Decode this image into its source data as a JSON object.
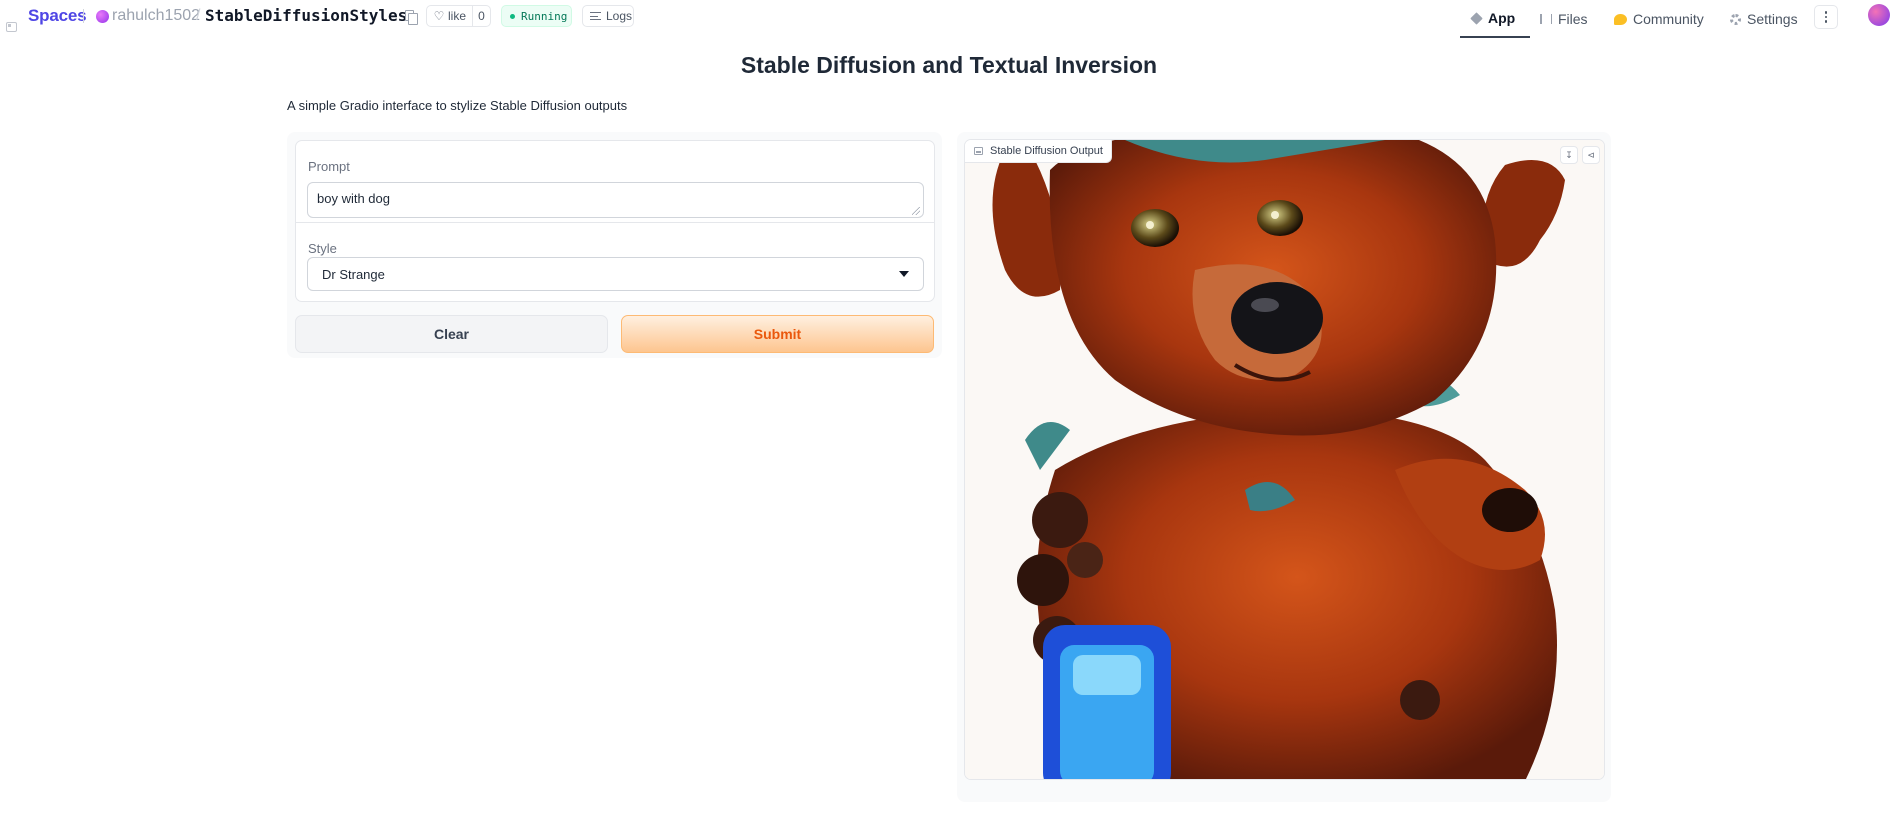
{
  "header": {
    "brand": "Spaces",
    "owner": "rahulch1502",
    "separator": "/",
    "repo": "StableDiffusionStyles",
    "like_label": "like",
    "like_count": "0",
    "status": "Running",
    "logs_label": "Logs",
    "nav": {
      "app": "App",
      "files": "Files",
      "community": "Community",
      "settings": "Settings"
    }
  },
  "main": {
    "title": "Stable Diffusion and Textual Inversion",
    "description": "A simple Gradio interface to stylize Stable Diffusion outputs",
    "prompt": {
      "label": "Prompt",
      "value": "boy with dog"
    },
    "style": {
      "label": "Style",
      "selected": "Dr Strange"
    },
    "buttons": {
      "clear": "Clear",
      "submit": "Submit"
    },
    "output": {
      "label": "Stable Diffusion Output"
    }
  },
  "colors": {
    "brand": "#4f46e5",
    "running_green": "#10b981",
    "submit_orange": "#ea580c",
    "submit_fill": "#fdc58f"
  }
}
